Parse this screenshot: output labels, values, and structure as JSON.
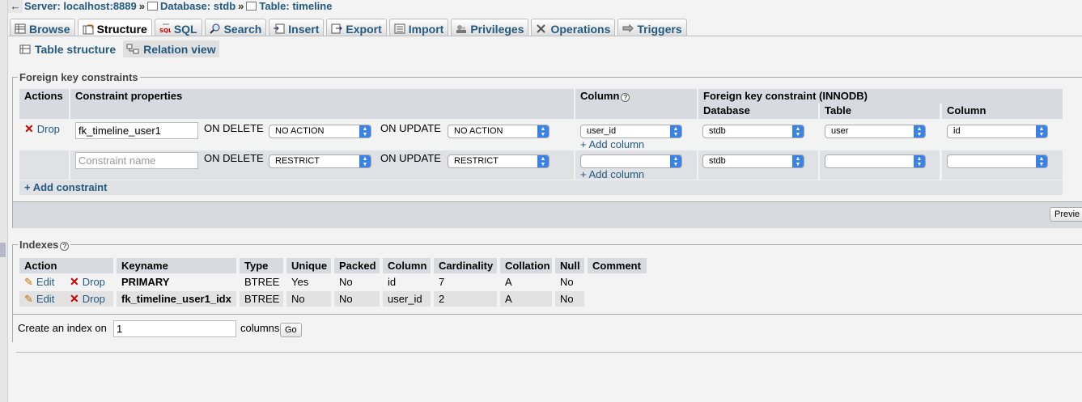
{
  "breadcrumb": {
    "back": "←",
    "server": "Server: localhost:8889",
    "database": "Database: stdb",
    "table": "Table: timeline",
    "separator": "»"
  },
  "tabs": [
    {
      "label": "Browse",
      "icon": "browse-icon"
    },
    {
      "label": "Structure",
      "icon": "structure-icon",
      "active": true
    },
    {
      "label": "SQL",
      "icon": "sql-icon"
    },
    {
      "label": "Search",
      "icon": "search-icon"
    },
    {
      "label": "Insert",
      "icon": "insert-icon"
    },
    {
      "label": "Export",
      "icon": "export-icon"
    },
    {
      "label": "Import",
      "icon": "import-icon"
    },
    {
      "label": "Privileges",
      "icon": "privileges-icon"
    },
    {
      "label": "Operations",
      "icon": "operations-icon"
    },
    {
      "label": "Triggers",
      "icon": "triggers-icon"
    }
  ],
  "subtabs": {
    "table_structure": "Table structure",
    "relation_view": "Relation view"
  },
  "fk": {
    "legend": "Foreign key constraints",
    "headers": {
      "actions": "Actions",
      "constraint_properties": "Constraint properties",
      "column": "Column",
      "fk_constraint": "Foreign key constraint (INNODB)",
      "database": "Database",
      "table": "Table",
      "ref_column": "Column"
    },
    "rows": [
      {
        "drop": "Drop",
        "name_value": "fk_timeline_user1",
        "on_delete_label": "ON DELETE",
        "on_delete": "NO ACTION",
        "on_update_label": "ON UPDATE",
        "on_update": "NO ACTION",
        "column": "user_id",
        "add_column": "+ Add column",
        "database": "stdb",
        "table": "user",
        "ref_column": "id"
      },
      {
        "name_placeholder": "Constraint name",
        "on_delete_label": "ON DELETE",
        "on_delete": "RESTRICT",
        "on_update_label": "ON UPDATE",
        "on_update": "RESTRICT",
        "column": "",
        "add_column": "+ Add column",
        "database": "stdb",
        "table": "",
        "ref_column": ""
      }
    ],
    "add_constraint": "+ Add constraint",
    "preview_button": "Previe"
  },
  "indexes": {
    "legend": "Indexes",
    "headers": [
      "Action",
      "Keyname",
      "Type",
      "Unique",
      "Packed",
      "Column",
      "Cardinality",
      "Collation",
      "Null",
      "Comment"
    ],
    "edit_label": "Edit",
    "drop_label": "Drop",
    "rows": [
      {
        "keyname": "PRIMARY",
        "type": "BTREE",
        "unique": "Yes",
        "packed": "No",
        "column": "id",
        "cardinality": "7",
        "collation": "A",
        "null": "No",
        "comment": ""
      },
      {
        "keyname": "fk_timeline_user1_idx",
        "type": "BTREE",
        "unique": "No",
        "packed": "No",
        "column": "user_id",
        "cardinality": "2",
        "collation": "A",
        "null": "No",
        "comment": ""
      }
    ],
    "create_label": "Create an index on",
    "create_value": "1",
    "columns_label": "columns",
    "go_button": "Go"
  },
  "colors": {
    "link": "#235a81",
    "header_bg": "#d7dbe0",
    "select_arrow": "#3b82e6",
    "drop_x": "#cc0000"
  }
}
